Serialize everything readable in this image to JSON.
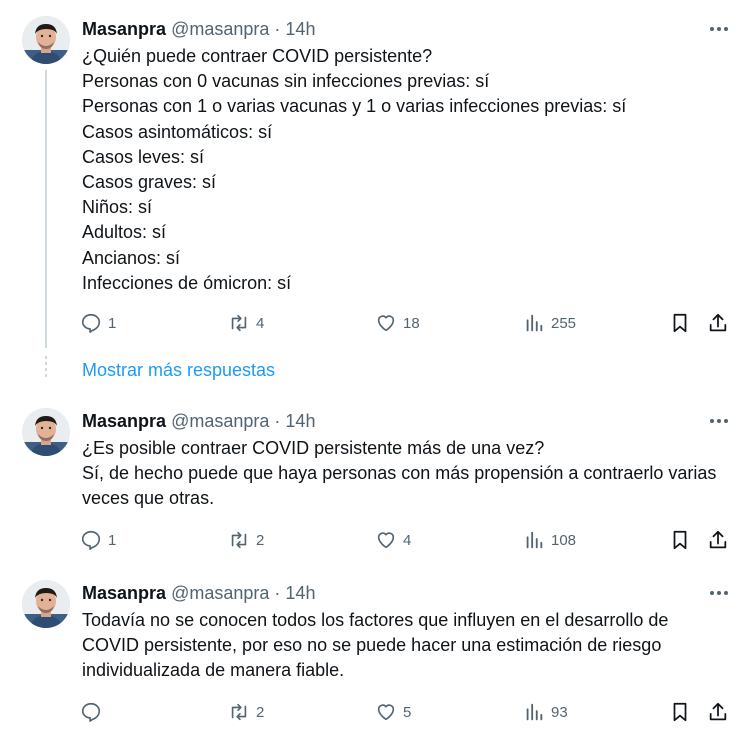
{
  "tweets": [
    {
      "name": "Masanpra",
      "handle": "@masanpra",
      "sep": "·",
      "time": "14h",
      "lines": [
        "¿Quién puede contraer COVID persistente?",
        "Personas con 0 vacunas sin infecciones previas: sí",
        "Personas con 1 o varias vacunas y 1 o varias infecciones previas: sí",
        "Casos asintomáticos: sí",
        "Casos leves: sí",
        "Casos graves: sí",
        "Niños: sí",
        "Adultos: sí",
        "Ancianos: sí",
        "Infecciones de ómicron: sí"
      ],
      "replies": "1",
      "retweets": "4",
      "likes": "18",
      "views": "255"
    },
    {
      "name": "Masanpra",
      "handle": "@masanpra",
      "sep": "·",
      "time": "14h",
      "lines": [
        "¿Es posible contraer COVID persistente más de una vez?",
        "Sí, de hecho puede que haya personas con más propensión a contraerlo varias",
        "veces que otras."
      ],
      "replies": "1",
      "retweets": "2",
      "likes": "4",
      "views": "108"
    },
    {
      "name": "Masanpra",
      "handle": "@masanpra",
      "sep": "·",
      "time": "14h",
      "lines": [
        "Todavía no se conocen todos los factores que influyen en el desarrollo de",
        "COVID persistente, por eso no se puede hacer una estimación de riesgo",
        "individualizada de manera fiable."
      ],
      "replies": "",
      "retweets": "2",
      "likes": "5",
      "views": "93"
    }
  ],
  "show_more_label": "Mostrar más respuestas",
  "icons": [
    "more-icon",
    "reply-icon",
    "retweet-icon",
    "like-icon",
    "views-icon",
    "bookmark-icon",
    "share-icon"
  ],
  "colors": {
    "accent": "#1d9bf0",
    "secondary_text": "#536471",
    "text": "#0f1419"
  }
}
